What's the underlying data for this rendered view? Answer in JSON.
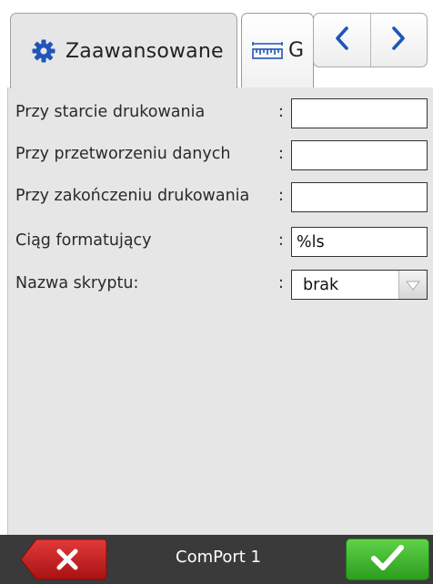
{
  "tabs": [
    {
      "label": "Zaawansowane",
      "icon": "gear-icon",
      "active": true
    },
    {
      "label": "G",
      "icon": "ruler-icon",
      "active": false
    }
  ],
  "nav": {
    "prev_icon": "chevron-left-icon",
    "next_icon": "chevron-right-icon"
  },
  "settings": {
    "rows": [
      {
        "label": "Przy starcie drukowania",
        "colon": ":",
        "value": ""
      },
      {
        "label": "Przy przetworzeniu danych",
        "colon": ":",
        "value": ""
      },
      {
        "label": "Przy zakończeniu drukowania",
        "colon": ":",
        "value": ""
      },
      {
        "label": "Ciąg formatujący",
        "colon": ":",
        "value": "%ls"
      }
    ],
    "script": {
      "label": "Nazwa skryptu:",
      "colon": ":",
      "value": "brak"
    }
  },
  "footer": {
    "title": "ComPort 1",
    "cancel_icon": "close-icon",
    "ok_icon": "checkmark-icon"
  },
  "colors": {
    "accent_blue": "#1f56b8",
    "cancel_red": "#c01b1b",
    "ok_green": "#3fb52c",
    "panel_bg": "#e6e6e6",
    "footer_bg": "#3a3a3a"
  }
}
